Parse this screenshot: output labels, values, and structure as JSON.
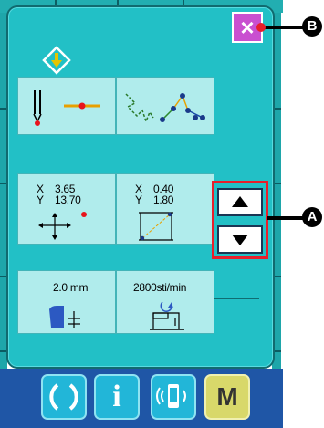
{
  "panel": {
    "close_label": "×"
  },
  "cells": {
    "move_xy": {
      "x_label": "X",
      "y_label": "Y",
      "x_value": "3.65",
      "y_value": "13.70"
    },
    "size_xy": {
      "x_label": "X",
      "y_label": "Y",
      "x_value": "0.40",
      "y_value": "1.80"
    },
    "pitch": {
      "value": "2.0 mm"
    },
    "speed": {
      "value": "2800sti/min"
    }
  },
  "bottom": {
    "info_label": "i",
    "mode_label": "M"
  },
  "callouts": {
    "a": "A",
    "b": "B"
  },
  "colors": {
    "panel": "#22c0c6",
    "cell": "#b0ecec",
    "close": "#c94fd0",
    "highlight": "#e81e2b",
    "bottom_bar": "#1f56a6"
  }
}
